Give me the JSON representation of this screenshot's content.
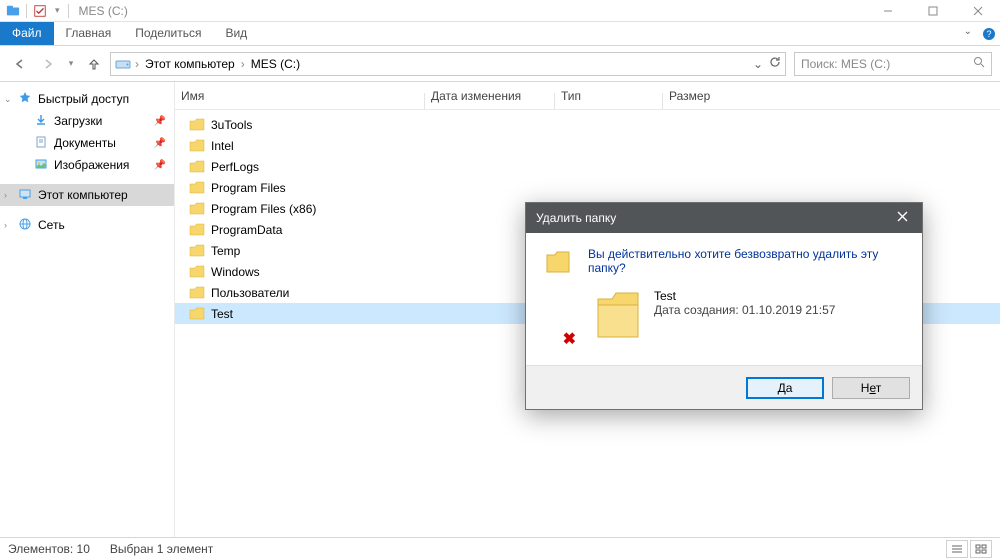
{
  "window": {
    "title": "MES (C:)"
  },
  "ribbon": {
    "file": "Файл",
    "tabs": [
      "Главная",
      "Поделиться",
      "Вид"
    ]
  },
  "nav": {
    "crumbs": [
      "Этот компьютер",
      "MES (C:)"
    ]
  },
  "search": {
    "placeholder": "Поиск: MES (C:)"
  },
  "sidebar": {
    "quick_access": "Быстрый доступ",
    "quick_items": [
      {
        "label": "Загрузки",
        "icon": "download",
        "pinned": true
      },
      {
        "label": "Документы",
        "icon": "document",
        "pinned": true
      },
      {
        "label": "Изображения",
        "icon": "image",
        "pinned": true
      }
    ],
    "this_pc": "Этот компьютер",
    "network": "Сеть"
  },
  "columns": {
    "name": "Имя",
    "date": "Дата изменения",
    "type": "Тип",
    "size": "Размер"
  },
  "files": [
    {
      "name": "3uTools"
    },
    {
      "name": "Intel"
    },
    {
      "name": "PerfLogs"
    },
    {
      "name": "Program Files"
    },
    {
      "name": "Program Files (x86)"
    },
    {
      "name": "ProgramData"
    },
    {
      "name": "Temp"
    },
    {
      "name": "Windows"
    },
    {
      "name": "Пользователи"
    },
    {
      "name": "Test",
      "selected": true
    }
  ],
  "status": {
    "count": "Элементов: 10",
    "selection": "Выбран 1 элемент"
  },
  "dialog": {
    "title": "Удалить папку",
    "question": "Вы действительно хотите безвозвратно удалить эту папку?",
    "item_name": "Test",
    "item_meta": "Дата создания: 01.10.2019 21:57",
    "yes_prefix": "Д",
    "yes_rest": "а",
    "no_prefix": "Н",
    "no_rest": "ет"
  }
}
